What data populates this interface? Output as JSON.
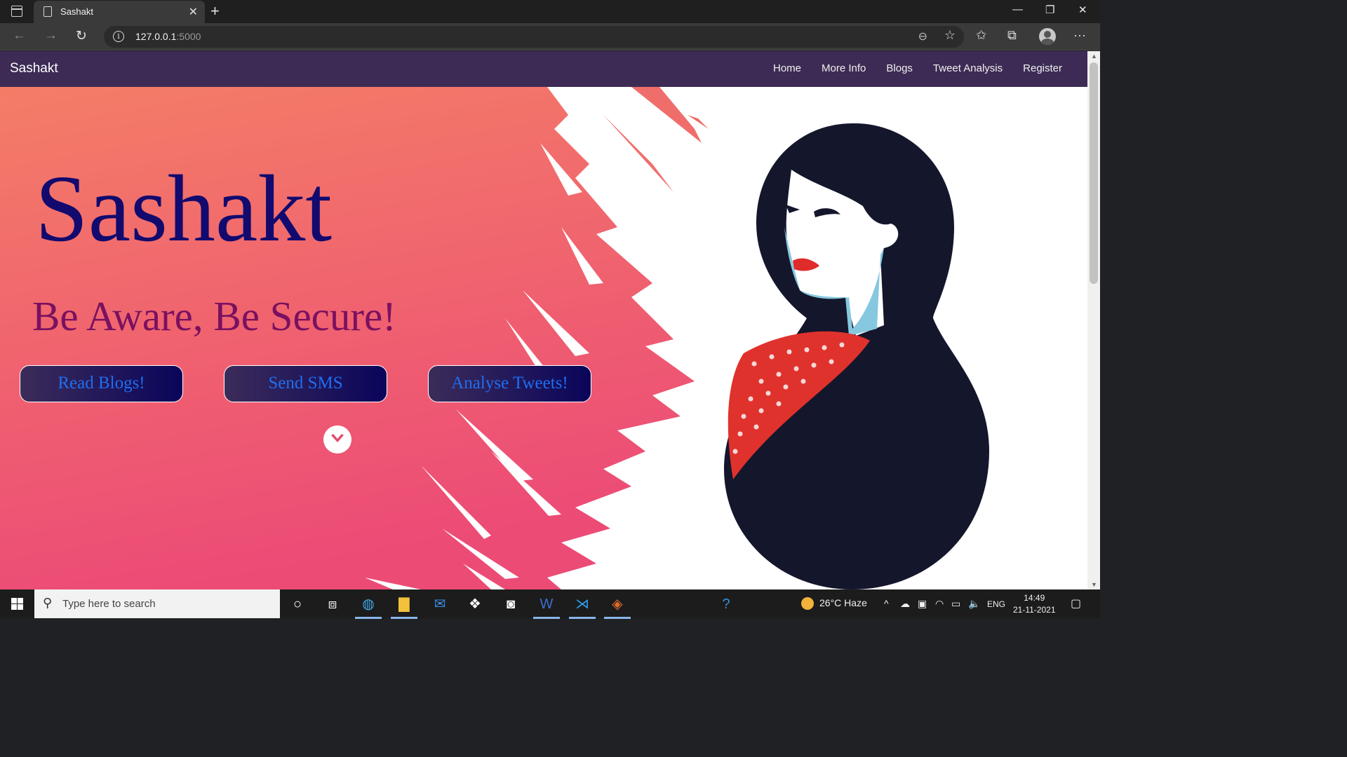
{
  "browser": {
    "tab_title": "Sashakt",
    "url_host": "127.0.0.1",
    "url_port": ":5000",
    "icons": [
      "tab-actions-icon",
      "page-icon",
      "close-icon",
      "new-tab-icon",
      "minimize-icon",
      "restore-icon",
      "window-close-icon",
      "back-icon",
      "forward-icon",
      "refresh-icon",
      "info-icon",
      "zoom-out-icon",
      "add-favorite-icon",
      "favorites-icon",
      "collections-icon",
      "profile-icon",
      "more-icon"
    ]
  },
  "site": {
    "brand": "Sashakt",
    "nav": [
      {
        "label": "Home"
      },
      {
        "label": "More Info"
      },
      {
        "label": "Blogs"
      },
      {
        "label": "Tweet Analysis"
      },
      {
        "label": "Register"
      }
    ],
    "hero": {
      "title": "Sashakt",
      "subtitle": "Be Aware, Be Secure!",
      "buttons": [
        {
          "label": "Read Blogs!"
        },
        {
          "label": "Send SMS"
        },
        {
          "label": "Analyse Tweets!"
        }
      ]
    },
    "colors": {
      "navbar": "#3d2b55",
      "gradient_top": "#f47d67",
      "gradient_bottom": "#ec4b76",
      "title": "#120a6e",
      "subtitle": "#7a1060",
      "button_text": "#1f6ef0"
    }
  },
  "taskbar": {
    "search_placeholder": "Type here to search",
    "weather": "26°C  Haze",
    "language": "ENG",
    "time": "14:49",
    "date": "21-11-2021",
    "apps": [
      "cortana-icon",
      "task-view-icon",
      "edge-icon",
      "file-explorer-icon",
      "mail-icon",
      "dropbox-icon",
      "app-icon",
      "word-icon",
      "vscode-icon",
      "git-icon",
      "help-icon"
    ]
  }
}
